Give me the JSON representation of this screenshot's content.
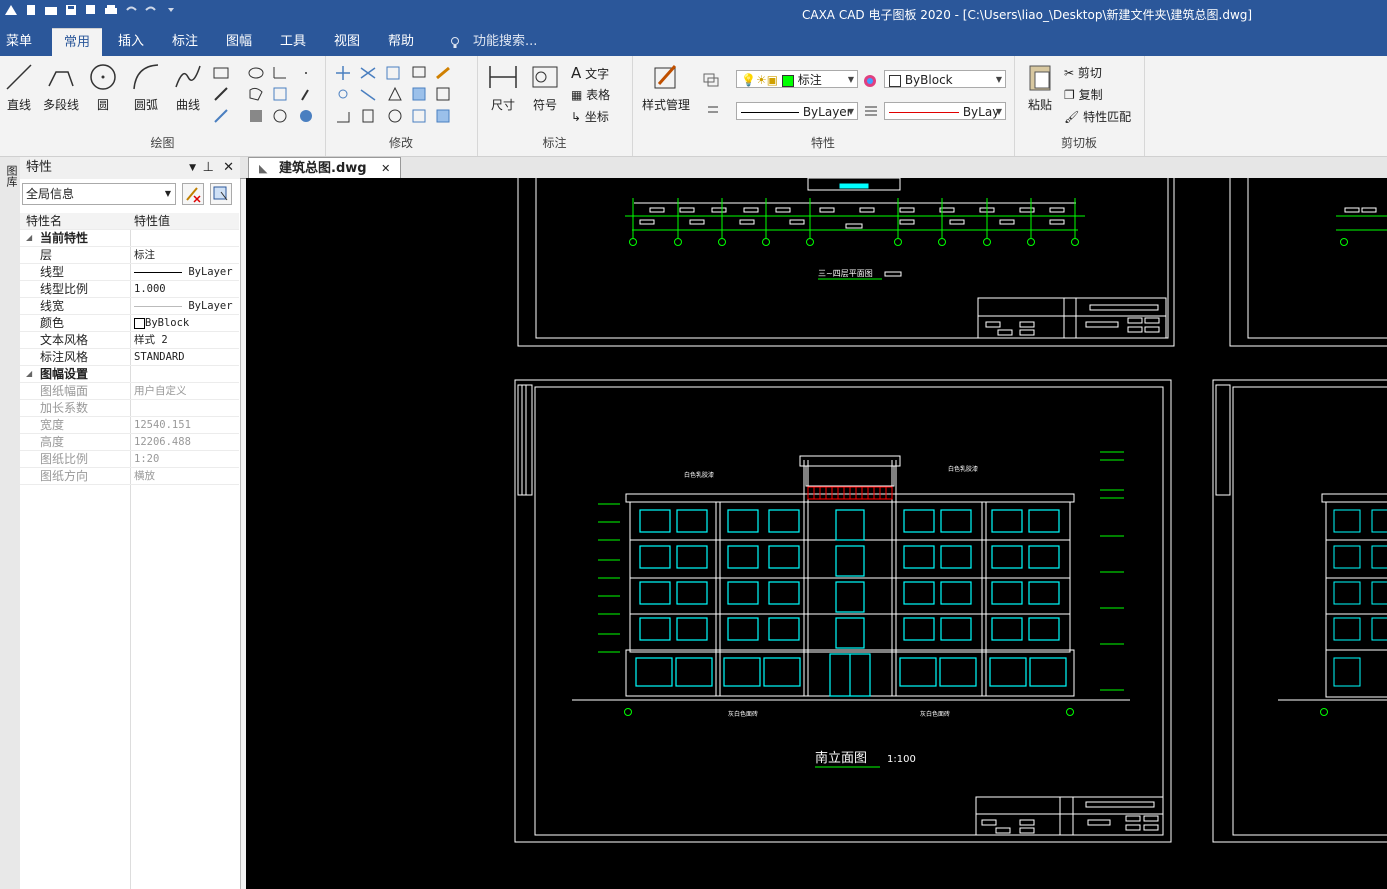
{
  "app": {
    "title": "CAXA CAD 电子图板 2020 - [C:\\Users\\liao_\\Desktop\\新建文件夹\\建筑总图.dwg]"
  },
  "menu": {
    "tabs": [
      "菜单",
      "常用",
      "插入",
      "标注",
      "图幅",
      "工具",
      "视图",
      "帮助"
    ],
    "active": "常用",
    "search_placeholder": "功能搜索..."
  },
  "ribbon": {
    "draw": {
      "label": "绘图",
      "buttons": [
        "直线",
        "多段线",
        "圆",
        "圆弧",
        "曲线"
      ]
    },
    "modify": {
      "label": "修改"
    },
    "annotate": {
      "label": "标注",
      "buttons": [
        "尺寸",
        "符号"
      ],
      "small": [
        "文字",
        "表格",
        "坐标"
      ]
    },
    "properties": {
      "label": "特性",
      "style_button": "样式管理",
      "layer_combo": "标注",
      "color_combo": "ByBlock",
      "linetype_combo": "ByLayer",
      "lineweight_combo": "ByLay"
    },
    "clipboard": {
      "label": "剪切板",
      "paste": "粘贴",
      "cut": "剪切",
      "copy": "复制",
      "match": "特性匹配"
    }
  },
  "panel": {
    "title": "特性",
    "left_strip": "图库",
    "combo": "全局信息",
    "col_name": "特性名",
    "col_value": "特性值",
    "current": {
      "label": "当前特性",
      "rows": [
        {
          "k": "层",
          "v": "标注"
        },
        {
          "k": "线型",
          "v": "ByLayer"
        },
        {
          "k": "线型比例",
          "v": "1.000"
        },
        {
          "k": "线宽",
          "v": "ByLayer"
        },
        {
          "k": "颜色",
          "v": "ByBlock"
        },
        {
          "k": "文本风格",
          "v": "样式 2"
        },
        {
          "k": "标注风格",
          "v": "STANDARD"
        }
      ]
    },
    "sheet": {
      "label": "图幅设置",
      "rows": [
        {
          "k": "图纸幅面",
          "v": "用户自定义"
        },
        {
          "k": "加长系数",
          "v": ""
        },
        {
          "k": "宽度",
          "v": "12540.151"
        },
        {
          "k": "高度",
          "v": "12206.488"
        },
        {
          "k": "图纸比例",
          "v": "1:20"
        },
        {
          "k": "图纸方向",
          "v": "横放"
        }
      ]
    }
  },
  "document": {
    "tab": "建筑总图.dwg"
  },
  "drawing": {
    "plan_title": "三~四层平面图",
    "elev_title": "南立面图",
    "elev_scale": "1:100",
    "note_top_left": "白色乳胶漆",
    "note_top_right": "白色乳胶漆",
    "note_bottom_left": "灰白色面砖",
    "note_bottom_right": "灰白色面砖"
  },
  "colors": {
    "ribbon_blue": "#2b579a",
    "canvas": "#000000",
    "cad_green": "#00ff00",
    "cad_cyan": "#00ffff",
    "cad_red": "#ff0000"
  }
}
